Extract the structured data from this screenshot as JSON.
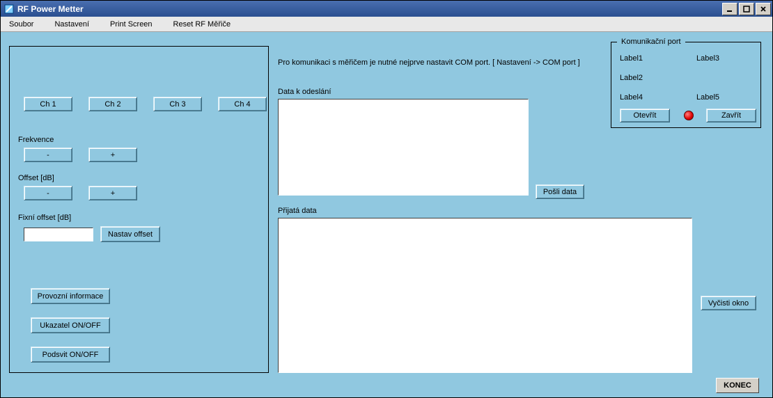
{
  "window": {
    "title": "RF Power Metter"
  },
  "menu": {
    "soubor": "Soubor",
    "nastaveni": "Nastavení",
    "printscreen": "Print Screen",
    "reset": "Reset RF Měřiče"
  },
  "channels": {
    "ch1": "Ch 1",
    "ch2": "Ch 2",
    "ch3": "Ch 3",
    "ch4": "Ch 4"
  },
  "labels": {
    "frekvence": "Frekvence",
    "offset_db": "Offset [dB]",
    "fixni_offset": "Fixní offset  [dB]",
    "data_k_odeslani": "Data k odeslání",
    "prijata_data": "Přijatá data",
    "instr": "Pro komunikaci s měřičem je nutné nejprve nastavit COM port. [ Nastavení -> COM port ]"
  },
  "buttons": {
    "minus1": "-",
    "plus1": "+",
    "minus2": "-",
    "plus2": "+",
    "nastav_offset": "Nastav offset",
    "provozni": "Provozní informace",
    "ukazatel": "Ukazatel ON/OFF",
    "podsvit": "Podsvit ON/OFF",
    "posli": "Pošli data",
    "vycisti": "Vyčisti okno",
    "konec": "KONEC"
  },
  "com": {
    "legend": "Komunikační port",
    "l1": "Label1",
    "l2": "Label2",
    "l3": "Label3",
    "l4": "Label4",
    "l5": "Label5",
    "open": "Otevřít",
    "close": "Zavřít"
  }
}
